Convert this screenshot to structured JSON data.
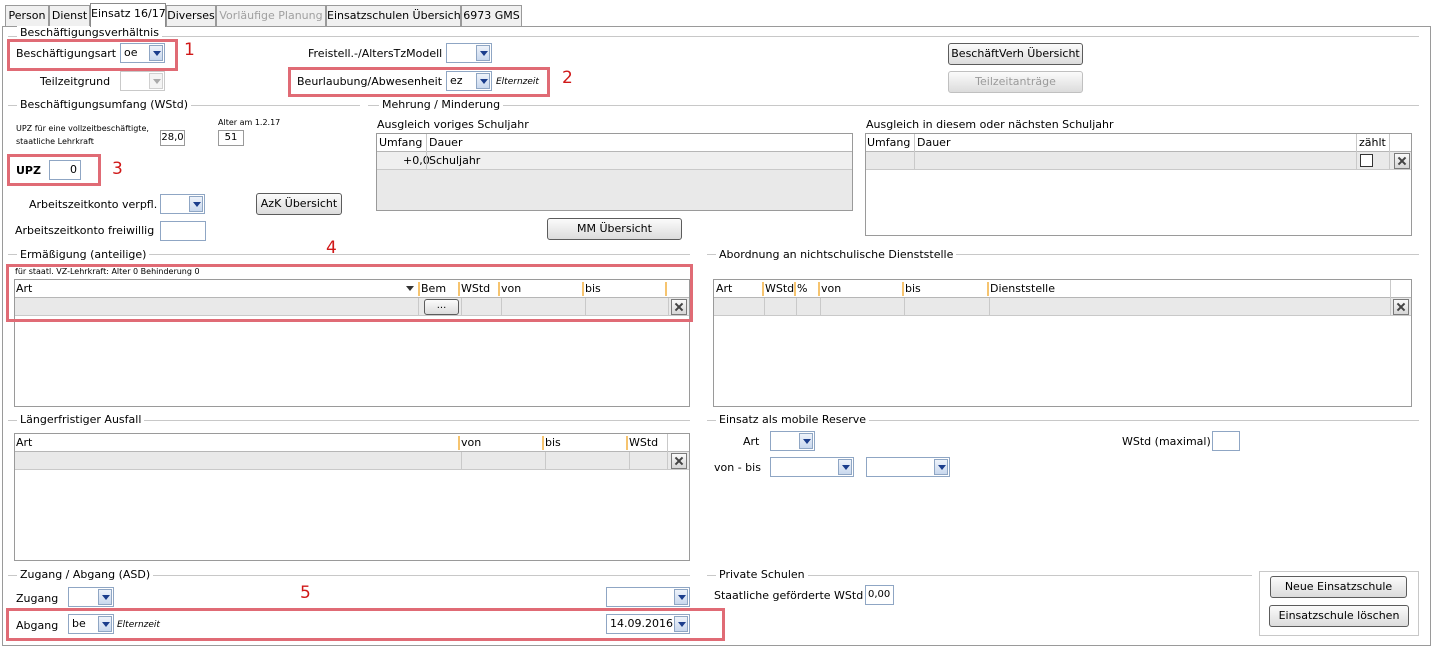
{
  "tabs": [
    {
      "label": "Person",
      "state": "normal"
    },
    {
      "label": "Dienst",
      "state": "normal"
    },
    {
      "label": "Einsatz 16/17",
      "state": "active"
    },
    {
      "label": "Diverses",
      "state": "normal"
    },
    {
      "label": "Vorläufige Planung",
      "state": "disabled"
    },
    {
      "label": "Einsatzschulen Übersicht",
      "state": "normal"
    },
    {
      "label": "6973 GMS",
      "state": "normal"
    }
  ],
  "beschaeftigung": {
    "title": "Beschäftigungsverhältnis",
    "art_label": "Beschäftigungsart",
    "art_value": "oe",
    "teilzeitgrund_label": "Teilzeitgrund",
    "teilzeitgrund_value": "",
    "freistell_label": "Freistell.-/AltersTzModell",
    "freistell_value": "",
    "beurlaubung_label": "Beurlaubung/Abwesenheit",
    "beurlaubung_value": "ez",
    "beurlaubung_text": "Elternzeit",
    "btn_uebersicht": "BeschäftVerh Übersicht",
    "btn_teilzeit": "Teilzeitanträge"
  },
  "umfang": {
    "title": "Beschäftigungsumfang (WStd)",
    "upz_desc_1": "UPZ für eine vollzeitbeschäftigte,",
    "upz_desc_2": "staatliche Lehrkraft",
    "upz_full_value": "28,0",
    "alter_label": "Alter am 1.2.17",
    "alter_value": "51",
    "upz_label": "UPZ",
    "upz_value": "0",
    "azk_verpfl_label": "Arbeitszeitkonto verpfl.",
    "azk_verpfl_value": "",
    "azk_frei_label": "Arbeitszeitkonto freiwillig",
    "azk_frei_value": "",
    "btn_azk": "AzK Übersicht"
  },
  "mehrung": {
    "title": "Mehrung / Minderung",
    "left_title": "Ausgleich voriges Schuljahr",
    "left_headers": [
      "Umfang",
      "Dauer"
    ],
    "left_row": {
      "umfang": "+0,0",
      "dauer": "Schuljahr"
    },
    "right_title": "Ausgleich in diesem oder nächsten Schuljahr",
    "right_headers": [
      "Umfang",
      "Dauer",
      "zählt"
    ],
    "btn_mm": "MM Übersicht"
  },
  "ermaessigung": {
    "title": "Ermäßigung (anteilige)",
    "info": "für staatl. VZ-Lehrkraft: Alter 0 Behinderung 0",
    "headers": [
      "Art",
      "Bem",
      "WStd",
      "von",
      "bis"
    ],
    "bem_button": "..."
  },
  "abordnung": {
    "title": "Abordnung an nichtschulische Dienststelle",
    "headers": [
      "Art",
      "WStd",
      "%",
      "von",
      "bis",
      "Dienststelle"
    ]
  },
  "ausfall": {
    "title": "Längerfristiger Ausfall",
    "headers": [
      "Art",
      "von",
      "bis",
      "WStd"
    ]
  },
  "reserve": {
    "title": "Einsatz als mobile Reserve",
    "art_label": "Art",
    "art_value": "",
    "wstd_label": "WStd (maximal)",
    "wstd_value": "",
    "vonbis_label": "von - bis",
    "von_value": "",
    "bis_value": ""
  },
  "zugang": {
    "title": "Zugang / Abgang (ASD)",
    "zugang_label": "Zugang",
    "zugang_value": "",
    "zugang_date": "",
    "abgang_label": "Abgang",
    "abgang_value": "be",
    "abgang_text": "Elternzeit",
    "abgang_date": "14.09.2016"
  },
  "privat": {
    "title": "Private Schulen",
    "label": "Staatliche geförderte WStd",
    "value": "0,00"
  },
  "actions": {
    "neue": "Neue Einsatzschule",
    "loeschen": "Einsatzschule löschen"
  },
  "annotations": [
    "1",
    "2",
    "3",
    "4",
    "5"
  ],
  "colors": {
    "highlight": "#e06b75",
    "annotation": "#d01818",
    "column_separator": "#f6c46f"
  }
}
